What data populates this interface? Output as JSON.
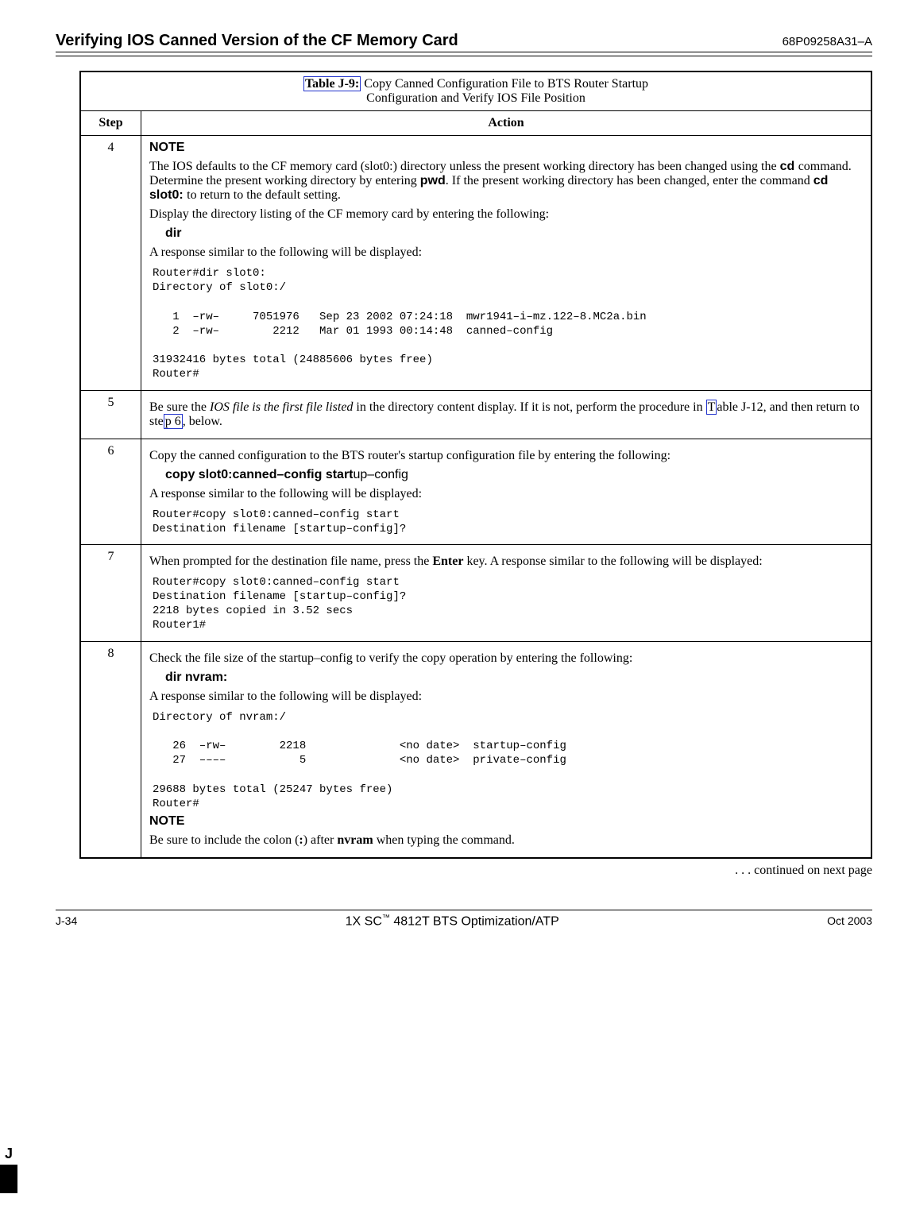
{
  "header": {
    "title": "Verifying IOS Canned Version of the CF Memory Card",
    "docnum": "68P09258A31–A"
  },
  "table": {
    "label": "Table J-9:",
    "caption_line1": " Copy Canned Configuration File to BTS Router Startup",
    "caption_line2": "Configuration and Verify IOS File Position",
    "col_step": "Step",
    "col_action": "Action"
  },
  "rows": {
    "r4": {
      "step": "4",
      "note_label": "NOTE",
      "p1a": "The IOS defaults to the CF memory card (slot0:) directory unless the present working directory has been changed using the ",
      "cd": " cd ",
      "p1b": " command. Determine the present working directory by entering ",
      "pwd": " pwd",
      "p1c": ". If the present working directory has been changed, enter the command ",
      "cdslot": " cd  slot0: ",
      "p1d": " to return to the default setting.",
      "p2": "Display the directory listing of the CF memory card by entering the following:",
      "cmd": "dir",
      "p3": "A response similar to the following will be displayed:",
      "mono": "Router#dir slot0:\nDirectory of slot0:/\n\n   1  –rw–     7051976   Sep 23 2002 07:24:18  mwr1941–i–mz.122–8.MC2a.bin\n   2  –rw–        2212   Mar 01 1993 00:14:48  canned–config\n\n31932416 bytes total (24885606 bytes free)\nRouter#"
    },
    "r5": {
      "step": "5",
      "p1a": "Be sure the ",
      "italic": "IOS file is the first file listed",
      "p1b": " in the directory content display. If it is not, perform the procedure in ",
      "link1": "T",
      "p1c": "able J-12, and then return to ste",
      "link2": "p 6",
      "p1d": ", below."
    },
    "r6": {
      "step": "6",
      "p1": "Copy the canned configuration to the BTS router's startup configuration file by entering the following:",
      "cmd_bold": "copy  slot0:canned–config  start",
      "cmd_tail": "up–config",
      "p2": "A response similar to the following will be displayed:",
      "mono": "Router#copy slot0:canned–config start\nDestination filename [startup–config]?"
    },
    "r7": {
      "step": "7",
      "p1a": "When prompted for the destination file name, press the ",
      "enter": "Enter",
      "p1b": " key. A response similar to the following will be displayed:",
      "mono": "Router#copy slot0:canned–config start\nDestination filename [startup–config]?\n2218 bytes copied in 3.52 secs\nRouter1#"
    },
    "r8": {
      "step": "8",
      "p1": "Check the file size of the startup–config to verify the copy operation by entering the following:",
      "cmd": "dir  nvram:",
      "p2": "A response similar to the following will be displayed:",
      "mono": "Directory of nvram:/\n\n   26  –rw–        2218              <no date>  startup–config\n   27  ––––           5              <no date>  private–config\n\n29688 bytes total (25247 bytes free)\nRouter#",
      "note_label": "NOTE",
      "note_a": "Be sure to include the colon (",
      "colon": ":",
      "note_b": ") after ",
      "nvram": "nvram",
      "note_c": " when typing the command."
    }
  },
  "continued": ". . . continued on next page",
  "side": {
    "letter": "J"
  },
  "footer": {
    "left": "J-34",
    "center_a": "1X SC",
    "center_tm": "™",
    "center_b": " 4812T BTS Optimization/ATP",
    "right": "Oct 2003"
  }
}
